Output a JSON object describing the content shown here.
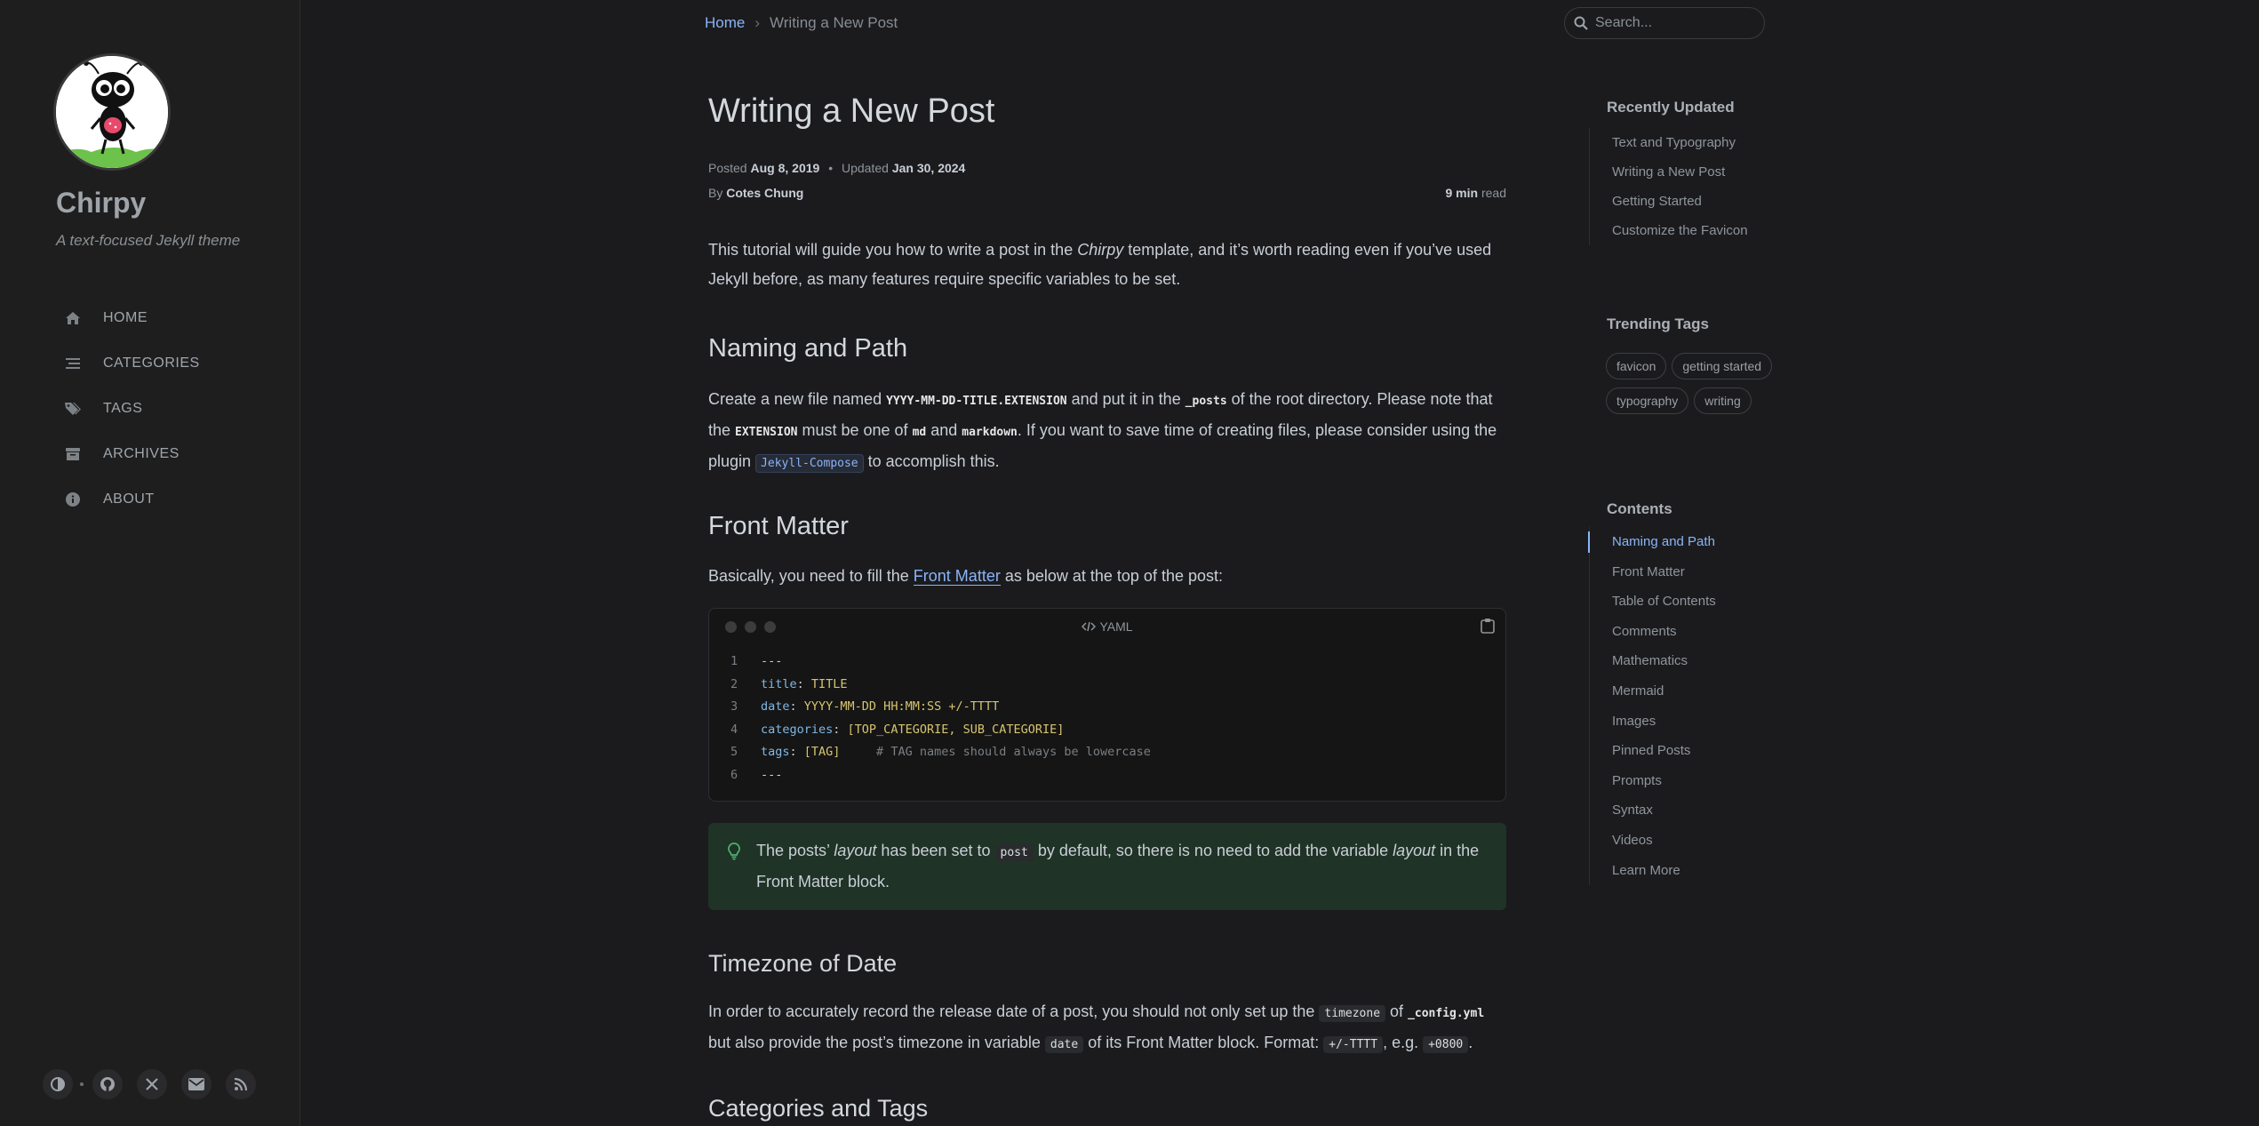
{
  "sidebar": {
    "site_title": "Chirpy",
    "site_subtitle": "A text-focused Jekyll theme",
    "nav": [
      {
        "label": "HOME",
        "icon": "home-icon"
      },
      {
        "label": "CATEGORIES",
        "icon": "list-icon"
      },
      {
        "label": "TAGS",
        "icon": "tags-icon"
      },
      {
        "label": "ARCHIVES",
        "icon": "archive-icon"
      },
      {
        "label": "ABOUT",
        "icon": "info-icon"
      }
    ],
    "bottom_icons": [
      "theme-toggle-icon",
      "github-icon",
      "x-icon",
      "email-icon",
      "rss-icon"
    ]
  },
  "topbar": {
    "breadcrumb_home": "Home",
    "breadcrumb_sep": "›",
    "breadcrumb_current": "Writing a New Post",
    "search_placeholder": "Search..."
  },
  "post": {
    "title": "Writing a New Post",
    "posted_label": "Posted",
    "posted_date": "Aug 8, 2019",
    "meta_sep": "•",
    "updated_label": "Updated",
    "updated_date": "Jan 30, 2024",
    "by_label": "By",
    "author": "Cotes Chung",
    "read_time": "9 min",
    "read_label": "read",
    "intro": {
      "t1": "This tutorial will guide you how to write a post in the ",
      "em": "Chirpy",
      "t2": " template, and it’s worth reading even if you’ve used Jekyll before, as many features require specific variables to be set."
    },
    "h_naming": "Naming and Path",
    "naming": {
      "t1": "Create a new file named ",
      "c1": "YYYY-MM-DD-TITLE.EXTENSION",
      "t2": " and put it in the ",
      "c2": "_posts",
      "t3": " of the root directory. Please note that the ",
      "c3": "EXTENSION",
      "t4": " must be one of ",
      "c4": "md",
      "t5": " and ",
      "c5": "markdown",
      "t6": ". If you want to save time of creating files, please consider using the plugin ",
      "c6": "Jekyll-Compose",
      "t7": " to accomplish this."
    },
    "h_front": "Front Matter",
    "front": {
      "t1": "Basically, you need to fill the ",
      "link": "Front Matter",
      "t2": " as below at the top of the post:"
    },
    "code": {
      "lang": "YAML",
      "lines": [
        {
          "n": "1",
          "k": "",
          "s": "",
          "v": "---",
          "c": ""
        },
        {
          "n": "2",
          "k": "title",
          "s": ": ",
          "v": "TITLE",
          "c": ""
        },
        {
          "n": "3",
          "k": "date",
          "s": ": ",
          "v": "YYYY-MM-DD HH:MM:SS +/-TTTT",
          "c": ""
        },
        {
          "n": "4",
          "k": "categories",
          "s": ": ",
          "v": "[TOP_CATEGORIE, SUB_CATEGORIE]",
          "c": ""
        },
        {
          "n": "5",
          "k": "tags",
          "s": ": ",
          "v": "[TAG]",
          "c": "     # TAG names should always be lowercase"
        },
        {
          "n": "6",
          "k": "",
          "s": "",
          "v": "---",
          "c": ""
        }
      ]
    },
    "tip": {
      "t1": "The posts’ ",
      "em1": "layout",
      "t2": " has been set to ",
      "c1": "post",
      "t3": " by default, so there is no need to add the variable ",
      "em2": "layout",
      "t4": " in the Front Matter block."
    },
    "h_timezone": "Timezone of Date",
    "timezone": {
      "t1": "In order to accurately record the release date of a post, you should not only set up the ",
      "c1": "timezone",
      "t2": " of ",
      "c2": "_config.yml",
      "t3": " but also provide the post’s timezone in variable ",
      "c3": "date",
      "t4": " of its Front Matter block. Format: ",
      "c4": "+/-TTTT",
      "t5": ", e.g. ",
      "c5": "+0800",
      "t6": "."
    },
    "h_categories": "Categories and Tags"
  },
  "panel": {
    "recent_title": "Recently Updated",
    "recent": [
      "Text and Typography",
      "Writing a New Post",
      "Getting Started",
      "Customize the Favicon"
    ],
    "tags_title": "Trending Tags",
    "tags": [
      "favicon",
      "getting started",
      "typography",
      "writing"
    ],
    "toc_title": "Contents",
    "toc": [
      "Naming and Path",
      "Front Matter",
      "Table of Contents",
      "Comments",
      "Mathematics",
      "Mermaid",
      "Images",
      "Pinned Posts",
      "Prompts",
      "Syntax",
      "Videos",
      "Learn More"
    ]
  },
  "colors": {
    "accent": "#8ab4f8",
    "background": "#1b1b1e",
    "tip_background": "#1f3326",
    "tip_icon": "#4caf73"
  }
}
